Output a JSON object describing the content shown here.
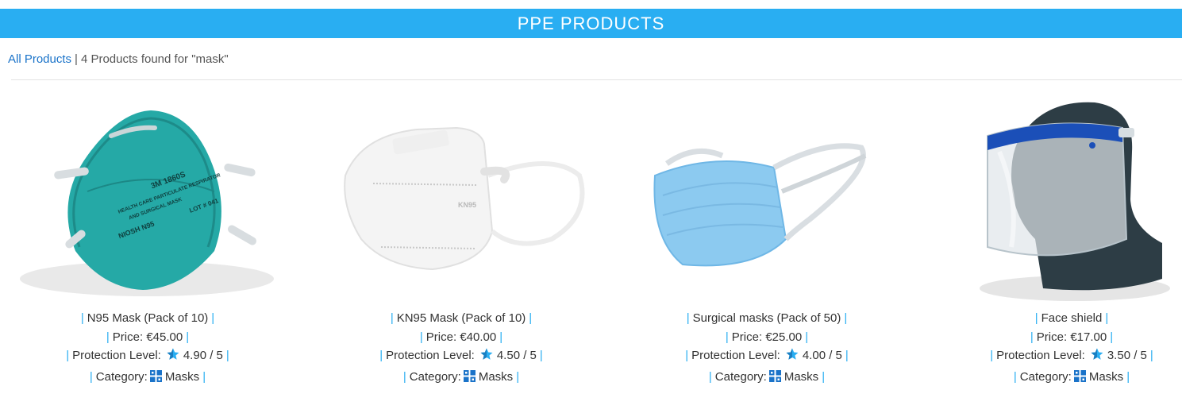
{
  "header": {
    "title": "PPE PRODUCTS"
  },
  "breadcrumb": {
    "link_label": "All Products",
    "separator": "|",
    "result_text": "4 Products found for \"mask\""
  },
  "labels": {
    "price": "Price:",
    "protection": "Protection Level:",
    "category": "Category:",
    "bar": "|"
  },
  "colors": {
    "accent": "#29aef2",
    "link": "#1a73c9"
  },
  "products": [
    {
      "name": "N95 Mask (Pack of 10)",
      "price": "€45.00",
      "rating": "4.90 / 5",
      "category": "Masks",
      "image": "n95-mask-image",
      "image_text": [
        "3M 1860S",
        "HEALTH CARE PARTICULATE RESPIRATOR",
        "AND SURGICAL MASK",
        "NIOSH N95",
        "LOT # 041"
      ]
    },
    {
      "name": "KN95 Mask (Pack of 10)",
      "price": "€40.00",
      "rating": "4.50 / 5",
      "category": "Masks",
      "image": "kn95-mask-image",
      "image_text": [
        "KN95"
      ]
    },
    {
      "name": "Surgical masks (Pack of 50)",
      "price": "€25.00",
      "rating": "4.00 / 5",
      "category": "Masks",
      "image": "surgical-mask-image"
    },
    {
      "name": "Face shield",
      "price": "€17.00",
      "rating": "3.50 / 5",
      "category": "Masks",
      "image": "face-shield-image"
    }
  ]
}
